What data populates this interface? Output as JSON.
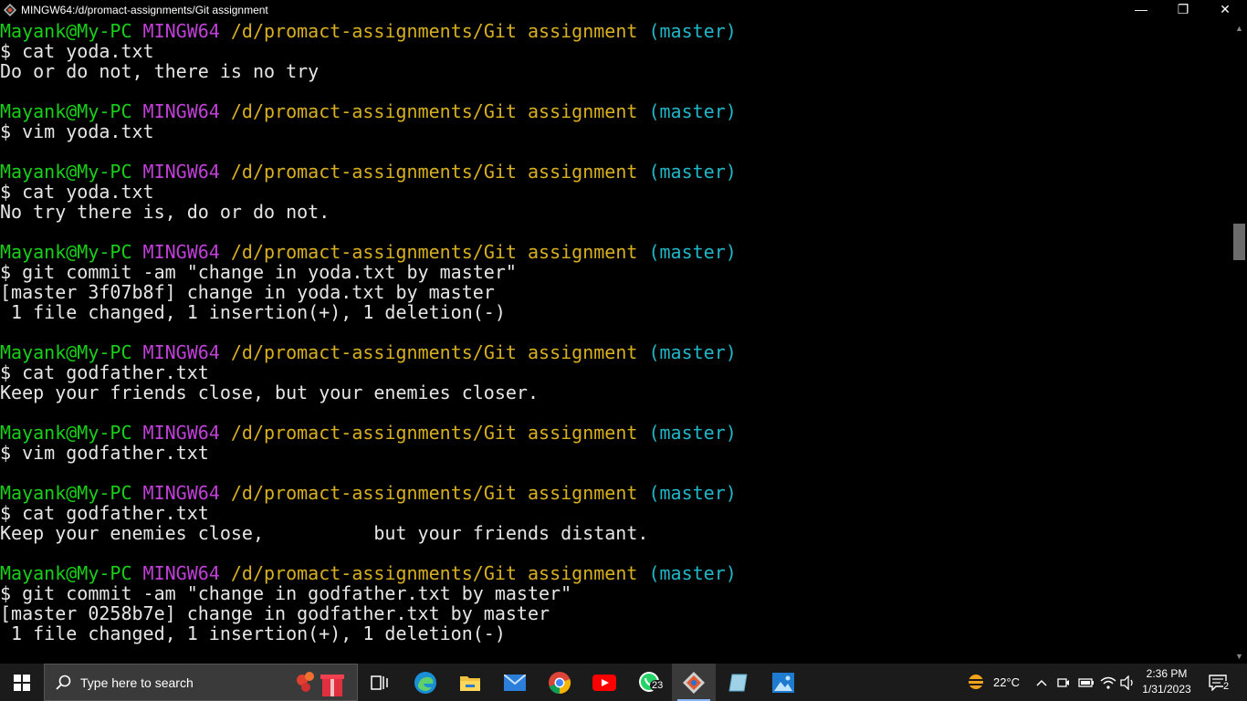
{
  "window": {
    "title": "MINGW64:/d/promact-assignments/Git assignment",
    "minimize": "—",
    "restore": "❐",
    "close": "✕"
  },
  "prompt": {
    "user": "Mayank@My-PC",
    "system": "MINGW64",
    "path": "/d/promact-assignments/Git assignment",
    "branch": "(master)"
  },
  "terminal": {
    "blocks": [
      {
        "command": "$ cat yoda.txt",
        "output": [
          "Do or do not, there is no try"
        ]
      },
      {
        "command": "$ vim yoda.txt",
        "output": []
      },
      {
        "command": "$ cat yoda.txt",
        "output": [
          "No try there is, do or do not."
        ]
      },
      {
        "command": "$ git commit -am \"change in yoda.txt by master\"",
        "output": [
          "[master 3f07b8f] change in yoda.txt by master",
          " 1 file changed, 1 insertion(+), 1 deletion(-)"
        ]
      },
      {
        "command": "$ cat godfather.txt",
        "output": [
          "Keep your friends close, but your enemies closer."
        ]
      },
      {
        "command": "$ vim godfather.txt",
        "output": []
      },
      {
        "command": "$ cat godfather.txt",
        "output": [
          "Keep your enemies close,          but your friends distant."
        ]
      },
      {
        "command": "$ git commit -am \"change in godfather.txt by master\"",
        "output": [
          "[master 0258b7e] change in godfather.txt by master",
          " 1 file changed, 1 insertion(+), 1 deletion(-)"
        ]
      }
    ]
  },
  "taskbar": {
    "search_placeholder": "Type here to search",
    "whatsapp_badge": "23",
    "weather": "22°C",
    "time": "2:36 PM",
    "date": "1/31/2023",
    "notifications": "2",
    "icons": [
      "task-view-icon",
      "edge-icon",
      "file-explorer-icon",
      "mail-icon",
      "chrome-icon",
      "youtube-icon",
      "whatsapp-icon",
      "git-bash-icon",
      "notepad-icon",
      "photos-icon"
    ]
  },
  "colors": {
    "user": "#18d018",
    "system": "#c040d8",
    "path": "#d8b020",
    "branch": "#20b8c8",
    "text": "#e6e6e6",
    "background": "#000000",
    "taskbar": "#1b1b1b"
  }
}
